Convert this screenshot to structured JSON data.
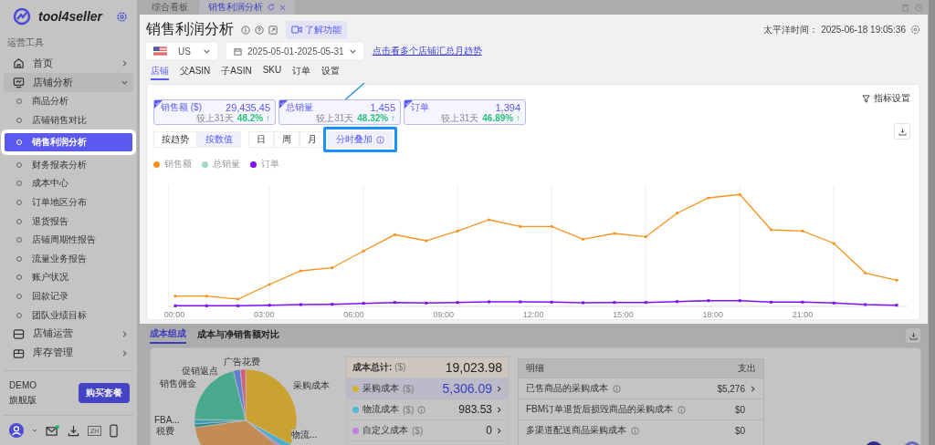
{
  "sidebar": {
    "brand": "tool4seller",
    "section_label": "运营工具",
    "nav": [
      {
        "label": "首页",
        "kind": "home",
        "expanded": false
      },
      {
        "label": "店铺分析",
        "kind": "monitor",
        "expanded": true,
        "children": [
          {
            "label": "商品分析",
            "selected": false
          },
          {
            "label": "店铺销售对比",
            "selected": false
          },
          {
            "label": "销售利润分析",
            "selected": true
          },
          {
            "label": "财务报表分析",
            "selected": false
          },
          {
            "label": "成本中心",
            "selected": false
          },
          {
            "label": "订单地区分布",
            "selected": false
          },
          {
            "label": "退货报告",
            "selected": false
          },
          {
            "label": "店铺周期性报告",
            "selected": false
          },
          {
            "label": "流量业务报告",
            "selected": false
          },
          {
            "label": "账户状况",
            "selected": false
          },
          {
            "label": "回款记录",
            "selected": false
          },
          {
            "label": "团队业绩目标",
            "selected": false
          }
        ]
      },
      {
        "label": "店铺运营",
        "kind": "store",
        "expanded": false
      },
      {
        "label": "库存管理",
        "kind": "box",
        "expanded": false
      }
    ],
    "account": {
      "plan": "DEMO",
      "edition": "旗舰版",
      "buy_button": "购买套餐"
    },
    "language": "ZH",
    "mail_unread": true
  },
  "page_tabs": [
    {
      "label": "综合看板",
      "selected": false
    },
    {
      "label": "销售利润分析",
      "selected": true
    }
  ],
  "header": {
    "title": "销售利润分析",
    "learn_button": "了解功能",
    "time": "太平洋时间： 2025-06-18 19:05:36"
  },
  "filters": {
    "country": "US",
    "date_range": "2025-05-01-2025-05-31",
    "link": "点击看多个店铺汇总月趋势"
  },
  "view_tabs": [
    {
      "label": "店铺",
      "selected": true
    },
    {
      "label": "父ASIN",
      "selected": false
    },
    {
      "label": "子ASIN",
      "selected": false
    },
    {
      "label": "SKU",
      "selected": false
    },
    {
      "label": "订单",
      "selected": false
    },
    {
      "label": "设置",
      "selected": false
    }
  ],
  "metric_settings": "指标设置",
  "metrics": [
    {
      "label": "销售额 ($)",
      "value": "29,435.45",
      "compare_label": "较上31天",
      "change": "48.2% ↑",
      "checked": true
    },
    {
      "label": "总销量",
      "value": "1,455",
      "compare_label": "较上31天",
      "change": "48.32% ↑",
      "checked": true
    },
    {
      "label": "订单",
      "value": "1,394",
      "compare_label": "较上31天",
      "change": "46.89% ↑",
      "checked": true
    }
  ],
  "mode_toggle": [
    {
      "label": "按趋势",
      "selected": false
    },
    {
      "label": "按数值",
      "selected": true
    }
  ],
  "granularity": [
    {
      "label": "日",
      "selected": false
    },
    {
      "label": "周",
      "selected": false
    },
    {
      "label": "月",
      "selected": false
    },
    {
      "label": "分时叠加",
      "selected": true
    }
  ],
  "legend": [
    {
      "label": "销售额",
      "color": "#f7931e"
    },
    {
      "label": "总销量",
      "color": "#a3d9c4"
    },
    {
      "label": "订单",
      "color": "#7b12fa"
    }
  ],
  "x_axis_labels": [
    "00:00",
    "03:00",
    "06:00",
    "09:00",
    "12:00",
    "15:00",
    "18:00",
    "21:00"
  ],
  "cost_tabs": [
    {
      "label": "成本组成",
      "selected": true
    },
    {
      "label": "成本与净销售额对比",
      "selected": false
    }
  ],
  "pie_labels": [
    "广告花费",
    "促销返点",
    "销售佣金",
    "FBA...",
    "税费",
    "采购成本",
    "物流..."
  ],
  "cost_summary": {
    "label": "成本总计:",
    "unit": "($)",
    "value": "19,023.98"
  },
  "cost_rows": [
    {
      "label": "采购成本",
      "unit": "($)",
      "value": "5,306.09",
      "color": "#d8b030",
      "info": false,
      "selected": true
    },
    {
      "label": "物流成本",
      "unit": "($)",
      "value": "983.53",
      "color": "#4fb8d2",
      "info": true,
      "selected": false
    },
    {
      "label": "自定义成本",
      "unit": "($)",
      "value": "0",
      "color": "#c47ee0",
      "info": false,
      "selected": false
    }
  ],
  "detail_table": {
    "columns": [
      "明细",
      "支出"
    ],
    "rows": [
      {
        "item": "已售商品的采购成本",
        "amount": "$5,276",
        "info": true,
        "link": true
      },
      {
        "item": "FBM订单退货后损毁商品的采购成本",
        "amount": "$0",
        "info": true,
        "link": false
      },
      {
        "item": "多渠道配送商品采购成本",
        "amount": "$0",
        "info": true,
        "link": false
      }
    ]
  }
}
